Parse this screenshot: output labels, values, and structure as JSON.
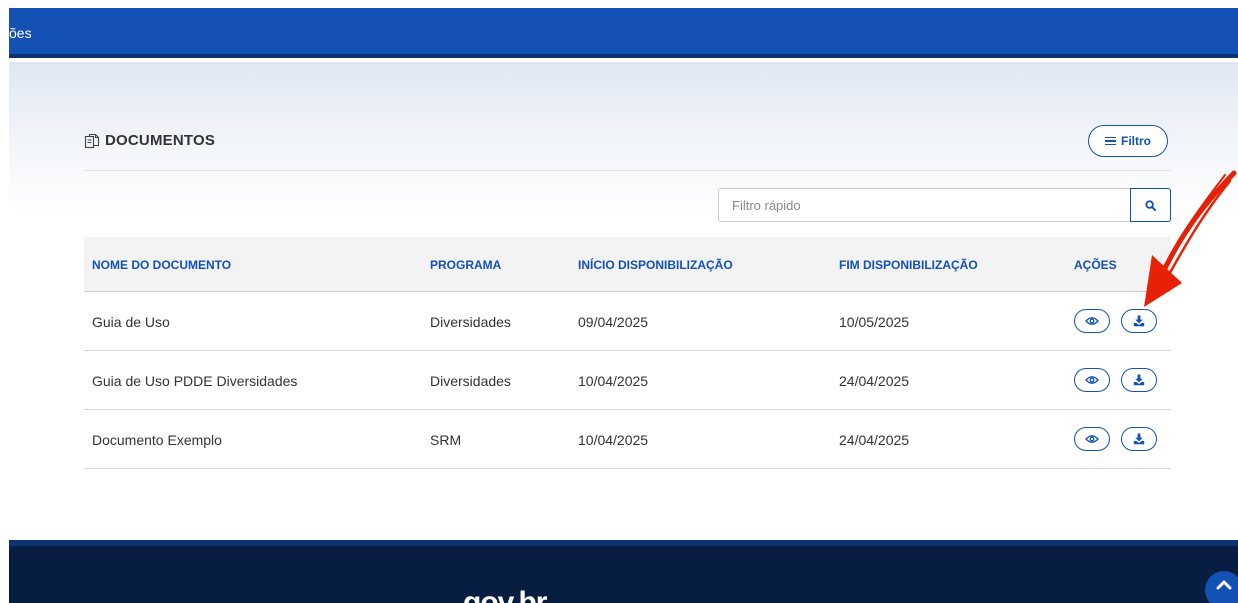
{
  "topbar": {
    "text": "ões",
    "color": "#1351b4"
  },
  "documents": {
    "title": "DOCUMENTOS",
    "filter_button_label": "Filtro",
    "search": {
      "placeholder": "Filtro rápido",
      "value": ""
    }
  },
  "table": {
    "headers": [
      "NOME DO DOCUMENTO",
      "PROGRAMA",
      "INÍCIO DISPONIBILIZAÇÃO",
      "FIM DISPONIBILIZAÇÃO",
      "AÇÕES"
    ],
    "rows": [
      {
        "name": "Guia de Uso",
        "program": "Diversidades",
        "start": "09/04/2025",
        "end": "10/05/2025"
      },
      {
        "name": "Guia de Uso PDDE Diversidades",
        "program": "Diversidades",
        "start": "10/04/2025",
        "end": "24/04/2025"
      },
      {
        "name": "Documento Exemplo",
        "program": "SRM",
        "start": "10/04/2025",
        "end": "24/04/2025"
      }
    ]
  },
  "footer": {
    "logo": "gov.br"
  },
  "icons": {
    "documents": "files-icon",
    "filter": "menu-icon",
    "search": "search-icon",
    "view": "eye-icon",
    "download": "download-icon",
    "scroll_top": "chevron-up-icon"
  },
  "colors": {
    "primary": "#1351b4",
    "footer": "#071d41",
    "annotation_arrow": "#e52207"
  }
}
